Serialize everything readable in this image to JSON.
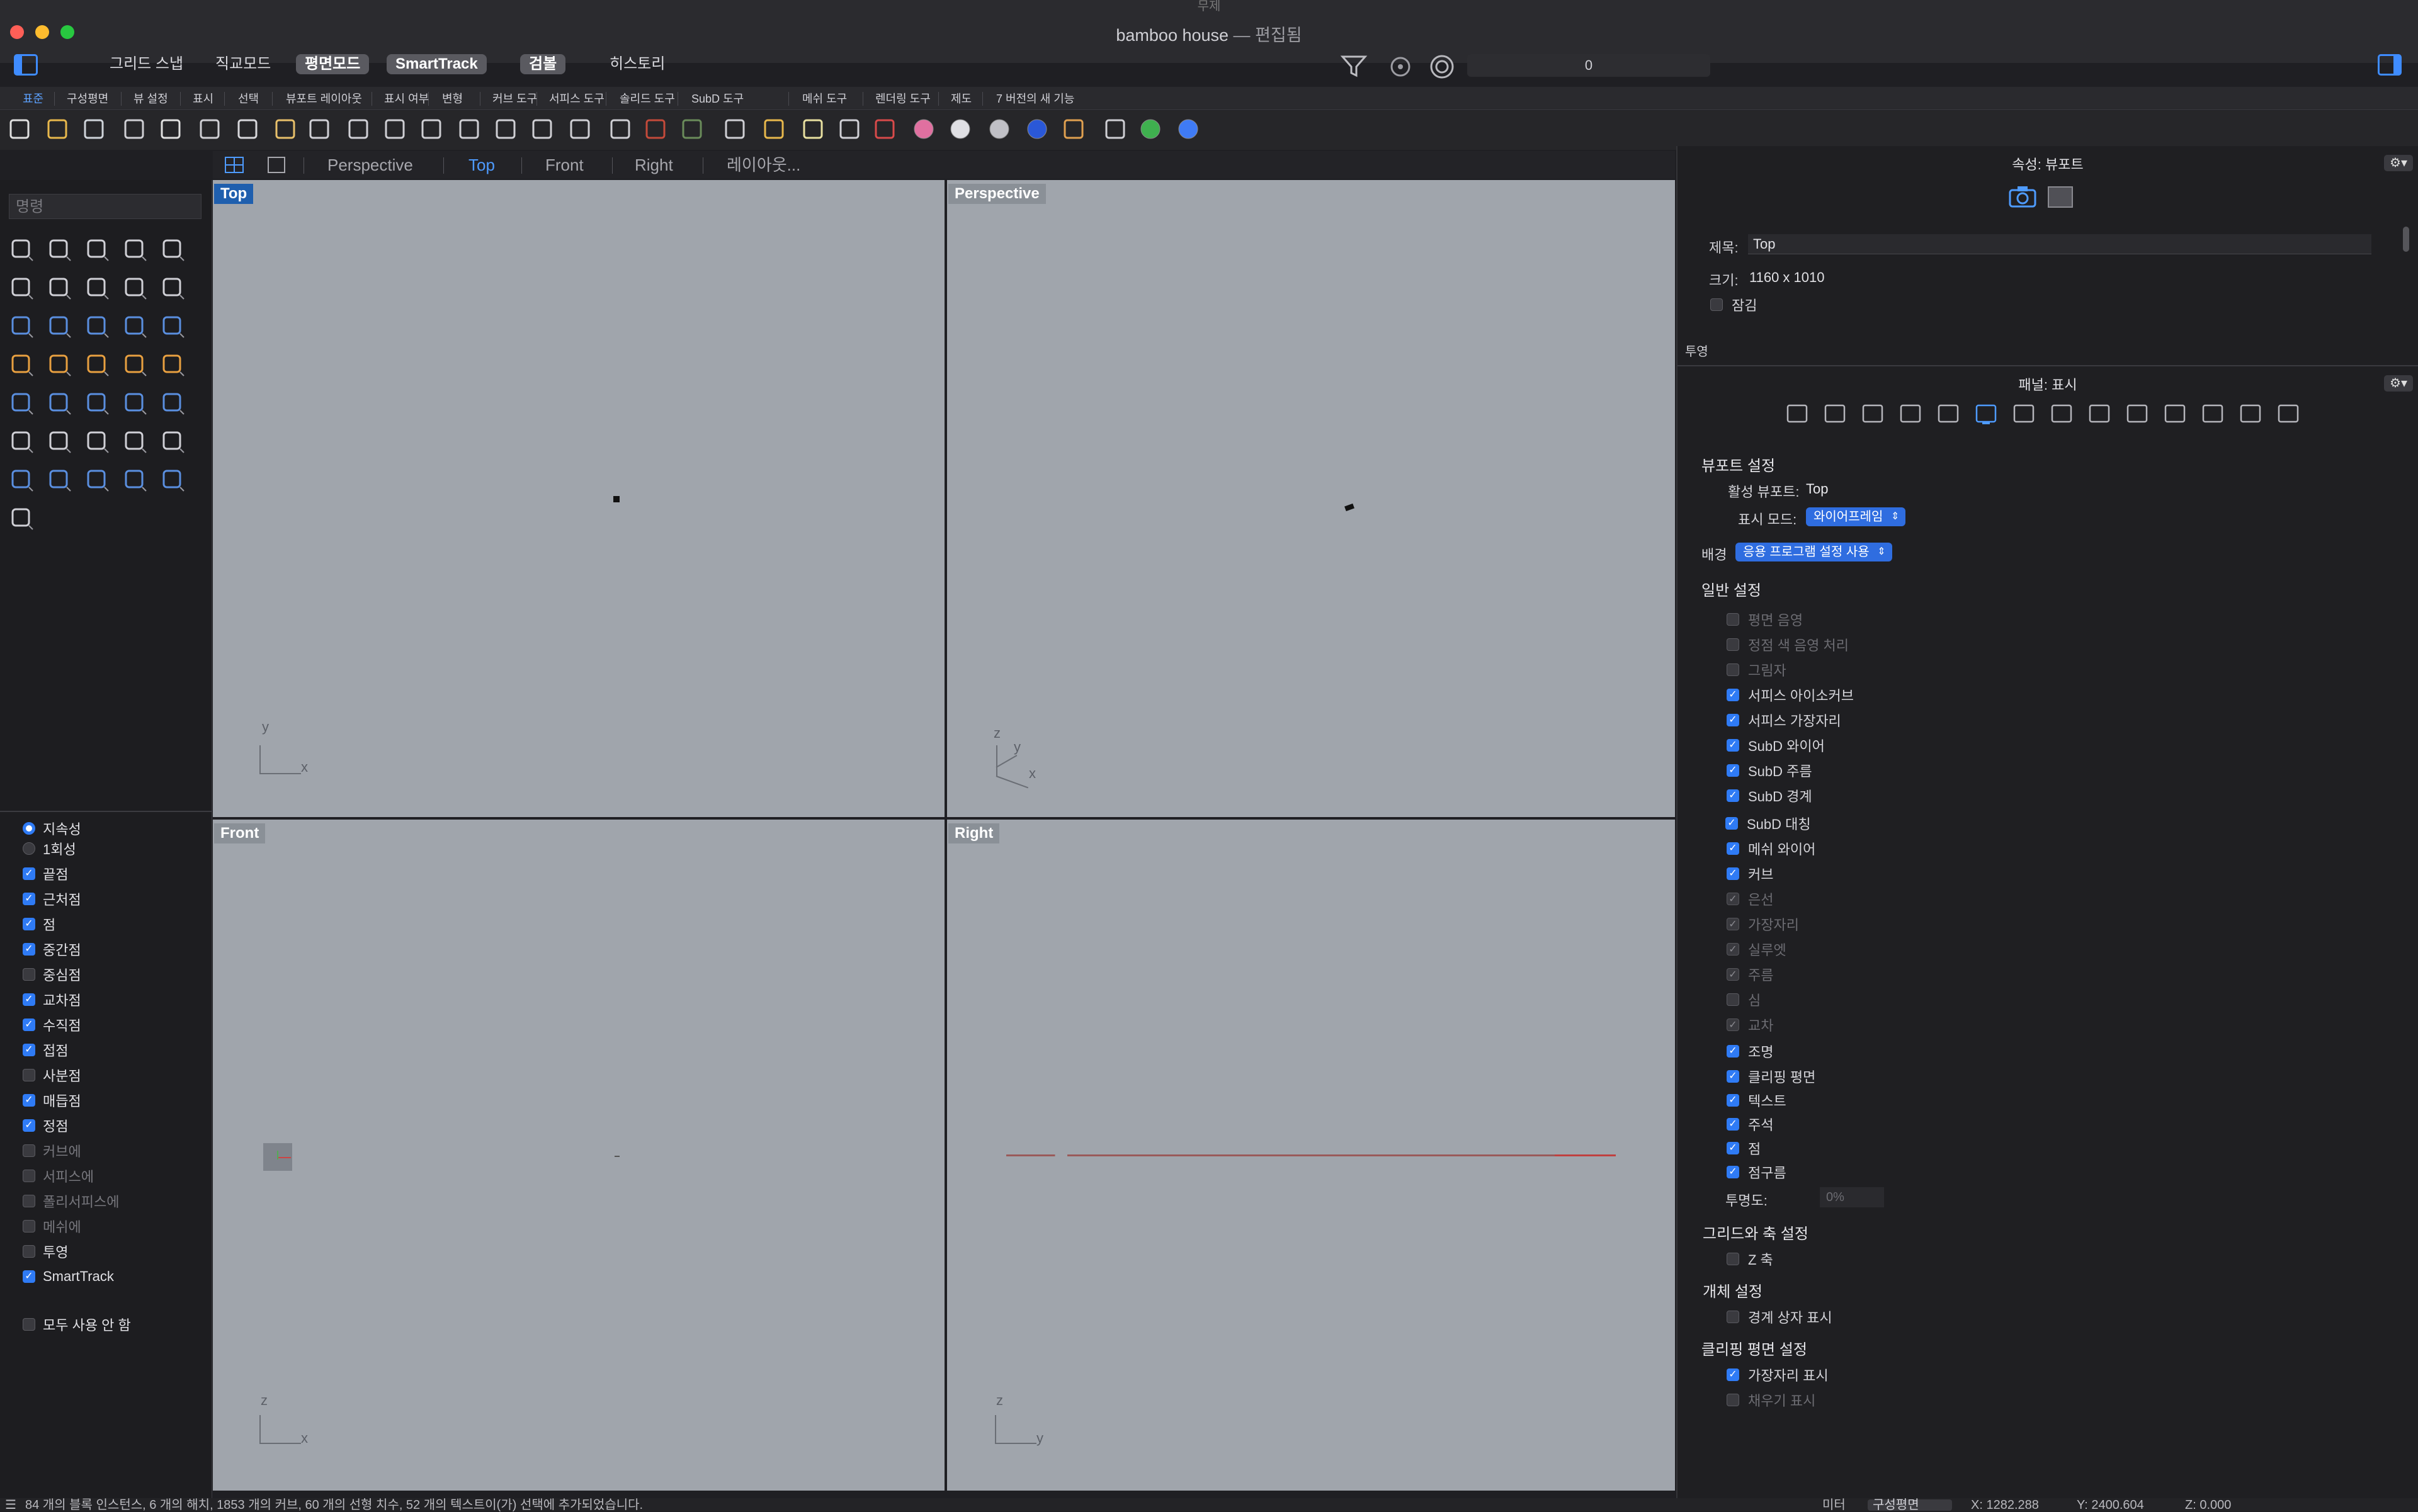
{
  "window": {
    "title": "bamboo house",
    "title_sep": "—",
    "title_status": "편집됨",
    "cut_top_label": "무제"
  },
  "modes": [
    "그리드 스냅",
    "직교모드",
    "평면모드",
    "SmartTrack",
    "검볼",
    "히스토리"
  ],
  "modes_on": [
    false,
    false,
    true,
    true,
    true,
    false
  ],
  "layer_field_value": "0",
  "tabs": [
    "표준",
    "구성평면",
    "뷰 설정",
    "표시",
    "선택",
    "뷰포트 레이아웃",
    "표시 여부",
    "변형",
    "커브 도구",
    "서피스 도구",
    "솔리드 도구",
    "SubD 도구",
    "메쉬 도구",
    "렌더링 도구",
    "제도",
    "7 버전의 새 기능"
  ],
  "active_tab": "표준",
  "viewport_tabs": [
    "Perspective",
    "Top",
    "Front",
    "Right",
    "레이아웃..."
  ],
  "active_viewport_tab": "Top",
  "command_placeholder": "명령",
  "osnap": {
    "mode_options": [
      {
        "label": "지속성",
        "selected": true
      },
      {
        "label": "1회성",
        "selected": false
      }
    ],
    "items": [
      {
        "label": "끝점",
        "checked": true
      },
      {
        "label": "근처점",
        "checked": true
      },
      {
        "label": "점",
        "checked": true
      },
      {
        "label": "중간점",
        "checked": true
      },
      {
        "label": "중심점",
        "checked": false
      },
      {
        "label": "교차점",
        "checked": true
      },
      {
        "label": "수직점",
        "checked": true
      },
      {
        "label": "접점",
        "checked": true
      },
      {
        "label": "사분점",
        "checked": false
      },
      {
        "label": "매듭점",
        "checked": true
      },
      {
        "label": "정점",
        "checked": true
      },
      {
        "label": "커브에",
        "checked": false,
        "disabled": true
      },
      {
        "label": "서피스에",
        "checked": false,
        "disabled": true
      },
      {
        "label": "폴리서피스에",
        "checked": false,
        "disabled": true
      },
      {
        "label": "메쉬에",
        "checked": false,
        "disabled": true
      },
      {
        "label": "투영",
        "checked": false
      },
      {
        "label": "SmartTrack",
        "checked": true
      }
    ],
    "disable_all": "모두 사용 안 함"
  },
  "viewports": {
    "top": {
      "label": "Top",
      "axis1": "y",
      "axis2": "x"
    },
    "perspective": {
      "label": "Perspective",
      "axis1": "z",
      "axis2": "y",
      "axis3": "x"
    },
    "front": {
      "label": "Front",
      "axis1": "z",
      "axis2": "x"
    },
    "right": {
      "label": "Right",
      "axis1": "z",
      "axis2": "y"
    }
  },
  "properties_panel": {
    "header": "속성: 뷰포트",
    "title_label": "제목:",
    "title_value": "Top",
    "size_label": "크기:",
    "size_value": "1160 x 1010",
    "lock_label": "잠김",
    "projection_label": "투영"
  },
  "display_panel": {
    "header": "패널: 표시",
    "viewport_settings": "뷰포트 설정",
    "active_viewport_label": "활성 뷰포트:",
    "active_viewport_value": "Top",
    "display_mode_label": "표시 모드:",
    "display_mode_value": "와이어프레임",
    "background_label": "배경",
    "background_value": "응용 프로그램 설정 사용",
    "general_settings": "일반 설정",
    "general_items": [
      {
        "label": "평면 음영",
        "state": "off",
        "disabled": true
      },
      {
        "label": "정점 색 음영 처리",
        "state": "off",
        "disabled": true
      },
      {
        "label": "그림자",
        "state": "off",
        "disabled": true
      },
      {
        "label": "서피스 아이소커브",
        "state": "on"
      },
      {
        "label": "서피스 가장자리",
        "state": "on"
      },
      {
        "label": "SubD 와이어",
        "state": "on"
      },
      {
        "label": "SubD 주름",
        "state": "on"
      },
      {
        "label": "SubD 경계",
        "state": "on"
      },
      {
        "label": "SubD 대칭",
        "state": "on"
      },
      {
        "label": "메쉬 와이어",
        "state": "on"
      },
      {
        "label": "커브",
        "state": "on"
      },
      {
        "label": "은선",
        "state": "dim",
        "disabled": true
      },
      {
        "label": "가장자리",
        "state": "dim",
        "disabled": true
      },
      {
        "label": "실루엣",
        "state": "dim",
        "disabled": true
      },
      {
        "label": "주름",
        "state": "dim",
        "disabled": true
      },
      {
        "label": "심",
        "state": "off",
        "disabled": true
      },
      {
        "label": "교차",
        "state": "dim",
        "disabled": true
      },
      {
        "label": "조명",
        "state": "on"
      },
      {
        "label": "클리핑 평면",
        "state": "on"
      },
      {
        "label": "텍스트",
        "state": "on"
      },
      {
        "label": "주석",
        "state": "on"
      },
      {
        "label": "점",
        "state": "on"
      },
      {
        "label": "점구름",
        "state": "on"
      }
    ],
    "transparency_label": "투명도:",
    "transparency_value": "0%",
    "grid_axis_settings": "그리드와 축 설정",
    "z_axis_label": "Z 축",
    "object_settings": "개체 설정",
    "bbox_label": "경계 상자 표시",
    "clipping_settings": "클리핑 평면 설정",
    "edge_display_label": "가장자리 표시",
    "fill_display_label": "채우기 표시"
  },
  "statusbar": {
    "message": "84 개의 블록 인스턴스, 6 개의 해치, 1853 개의 커브, 60 개의 선형 치수, 52 개의 텍스트이(가) 선택에 추가되었습니다.",
    "units": "미터",
    "cplane": "구성평면",
    "x": "X: 1282.288",
    "y": "Y: 2400.604",
    "z": "Z: 0.000"
  },
  "colors": {
    "accent": "#2f7bf5",
    "viewport_bg": "#a0a5ac",
    "active_label": "#1f5fae"
  }
}
